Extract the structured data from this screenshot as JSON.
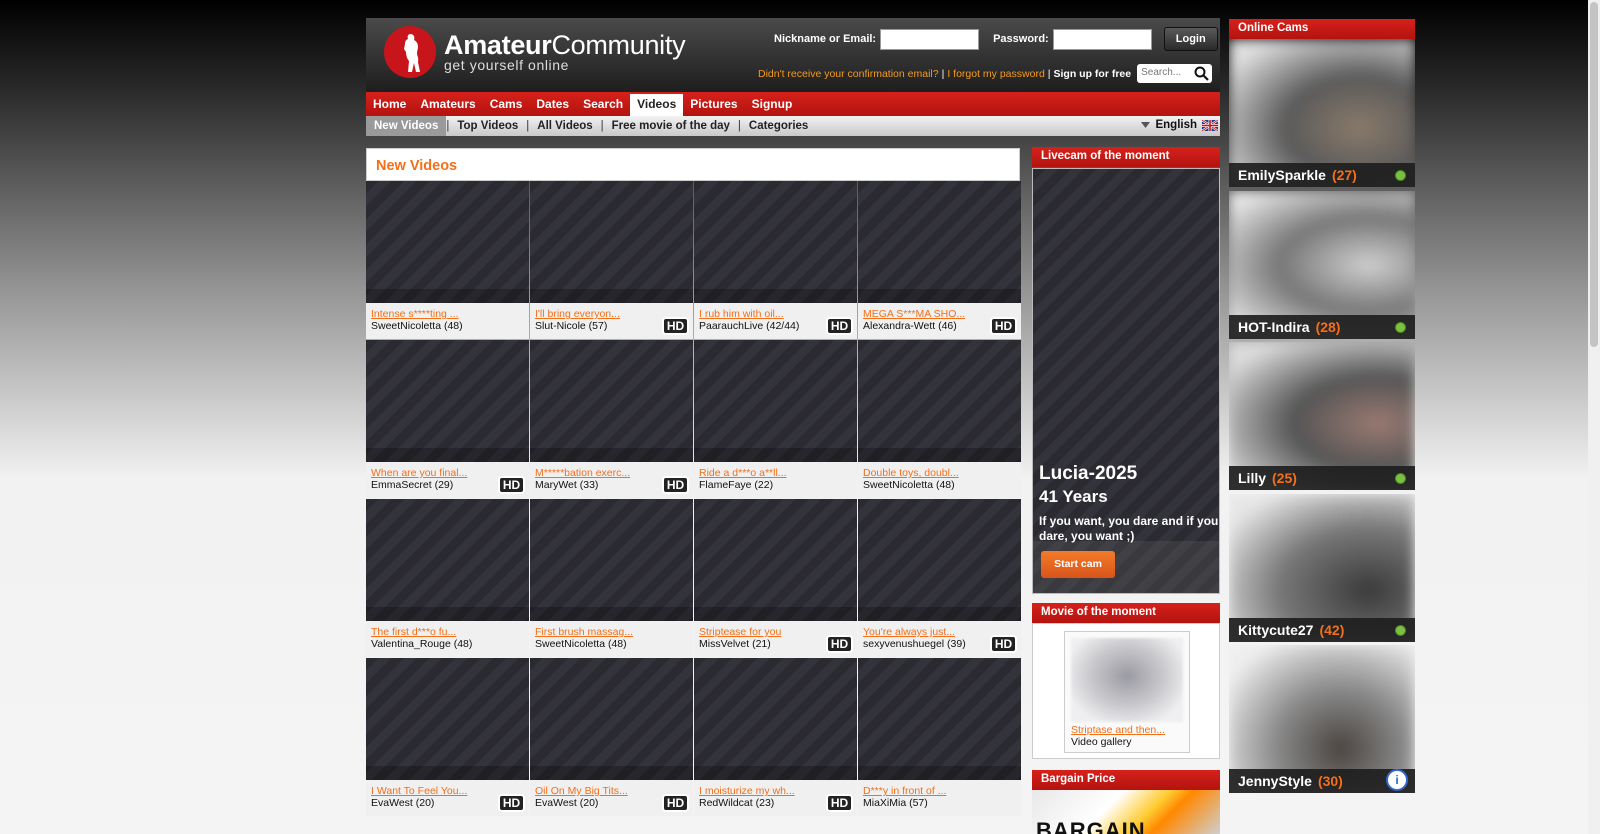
{
  "header": {
    "brand_bold": "Amateur",
    "brand_light": "Community",
    "tagline": "get yourself online",
    "nickname_label": "Nickname or Email:",
    "password_label": "Password:",
    "login_button": "Login",
    "confirm_link": "Didn't receive your confirmation email?",
    "forgot_link": "I forgot my password",
    "signup_link": "Sign up for free",
    "search_placeholder": "Search..."
  },
  "nav": {
    "items": [
      "Home",
      "Amateurs",
      "Cams",
      "Dates",
      "Search",
      "Videos",
      "Pictures",
      "Signup"
    ],
    "active": "Videos"
  },
  "subnav": {
    "items": [
      "New Videos",
      "Top Videos",
      "All Videos",
      "Free movie of the day",
      "Categories"
    ],
    "active": "New Videos",
    "language": "English"
  },
  "main": {
    "title": "New Videos",
    "videos": [
      {
        "title": "Intense s****ting ...",
        "user": "SweetNicoletta (48)",
        "hd": false
      },
      {
        "title": "I'll bring everyon...",
        "user": "Slut-Nicole (57)",
        "hd": true
      },
      {
        "title": "I rub him with oil...",
        "user": "PaarauchLive (42/44)",
        "hd": true
      },
      {
        "title": "MEGA S***MA SHO...",
        "user": "Alexandra-Wett (46)",
        "hd": true
      },
      {
        "title": "When are you final...",
        "user": "EmmaSecret (29)",
        "hd": true
      },
      {
        "title": "M*****bation exerc...",
        "user": "MaryWet (33)",
        "hd": true
      },
      {
        "title": "Ride a d***o a**ll...",
        "user": "FlameFaye (22)",
        "hd": false
      },
      {
        "title": "Double toys, doubl...",
        "user": "SweetNicoletta (48)",
        "hd": false
      },
      {
        "title": "The first d***o fu...",
        "user": "Valentina_Rouge (48)",
        "hd": false
      },
      {
        "title": "First brush massag...",
        "user": "SweetNicoletta (48)",
        "hd": false
      },
      {
        "title": "Striptease for you",
        "user": "MissVelvet (21)",
        "hd": true
      },
      {
        "title": "You're always just...",
        "user": "sexyvenushuegel (39)",
        "hd": true
      },
      {
        "title": "I Want To Feel You...",
        "user": "EvaWest (20)",
        "hd": true
      },
      {
        "title": "Oil On My Big Tits...",
        "user": "EvaWest (20)",
        "hd": true
      },
      {
        "title": "I moisturize my wh...",
        "user": "RedWildcat (23)",
        "hd": true
      },
      {
        "title": "D***y in front of ...",
        "user": "MiaXiMia (57)",
        "hd": false
      }
    ],
    "hd_label": "HD"
  },
  "livecam": {
    "heading": "Livecam of the moment",
    "name": "Lucia-2025",
    "age": "41 Years",
    "quote": "If you want, you dare and if you dare, you want ;)",
    "button": "Start cam"
  },
  "movie": {
    "heading": "Movie of the moment",
    "title": "Striptase and then...",
    "subtitle": "Video gallery"
  },
  "bargain": {
    "heading": "Bargain Price",
    "image_text": "BARGAIN PRICE"
  },
  "online_cams": {
    "heading": "Online Cams",
    "cams": [
      {
        "name": "EmilySparkle",
        "age": "(27)",
        "status": "online"
      },
      {
        "name": "HOT-Indira",
        "age": "(28)",
        "status": "online"
      },
      {
        "name": "Lilly",
        "age": "(25)",
        "status": "online"
      },
      {
        "name": "Kittycute27",
        "age": "(42)",
        "status": "online"
      },
      {
        "name": "JennyStyle",
        "age": "(30)",
        "status": "private"
      }
    ]
  },
  "colors": {
    "brand_red": "#c8151b",
    "accent_orange": "#f36f19",
    "online_green": "#7bc043"
  }
}
